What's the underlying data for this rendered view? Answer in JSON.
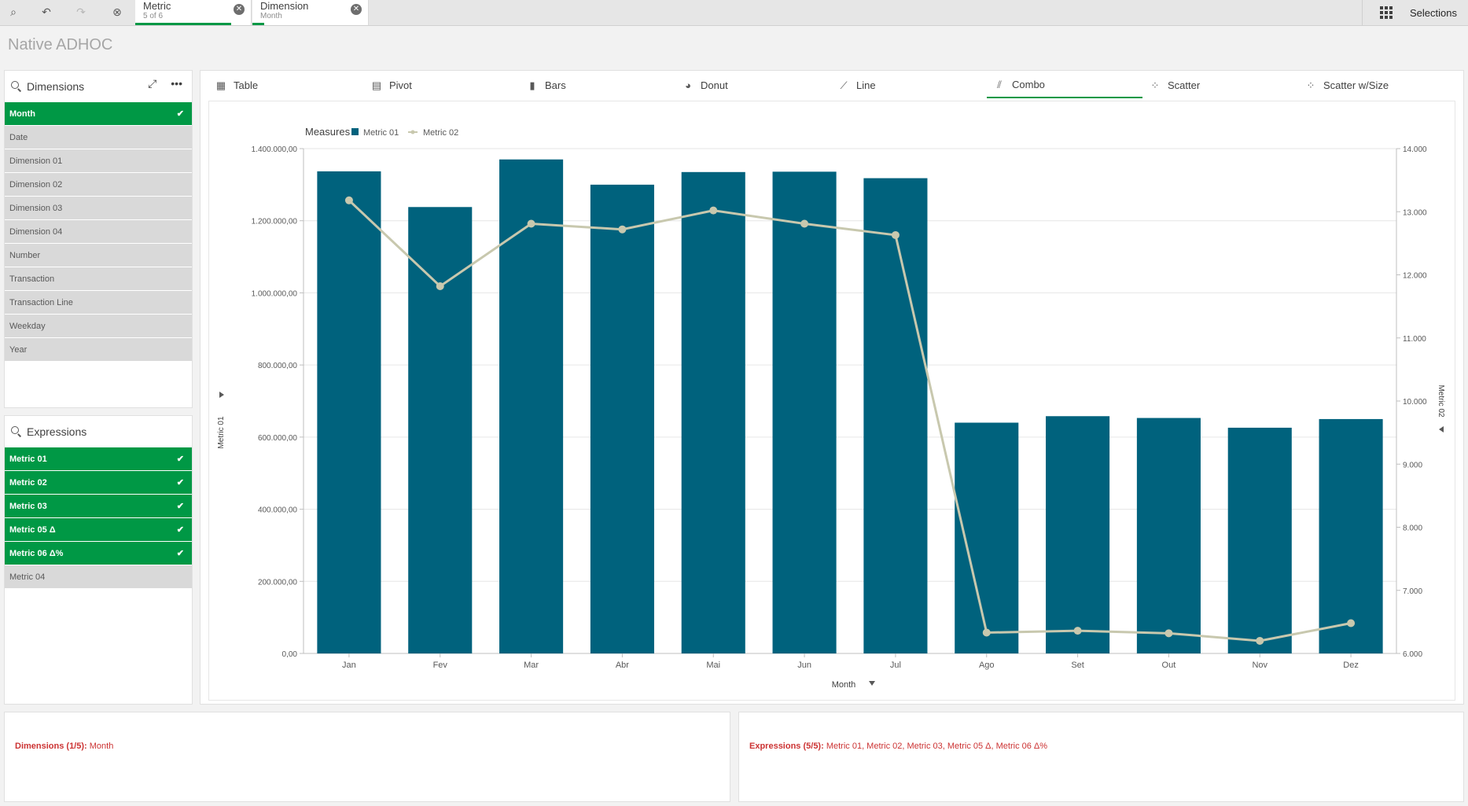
{
  "toolbar": {
    "buttons": [
      {
        "name": "smart-search-icon",
        "glyph": "⌕",
        "disabled": false
      },
      {
        "name": "step-back-icon",
        "glyph": "↶",
        "disabled": false
      },
      {
        "name": "step-forward-icon",
        "glyph": "↷",
        "disabled": true
      },
      {
        "name": "clear-all-selections-icon",
        "glyph": "⊗",
        "disabled": false
      }
    ],
    "chips": [
      {
        "title": "Metric",
        "subtitle": "5 of 6",
        "progress": 0.833
      },
      {
        "title": "Dimension",
        "subtitle": "Month",
        "progress": 0.1
      }
    ],
    "selections_label": "Selections"
  },
  "app_title": "Native ADHOC",
  "dimensions": {
    "title": "Dimensions",
    "items": [
      {
        "label": "Month",
        "selected": true
      },
      {
        "label": "Date",
        "selected": false
      },
      {
        "label": "Dimension 01",
        "selected": false
      },
      {
        "label": "Dimension 02",
        "selected": false
      },
      {
        "label": "Dimension 03",
        "selected": false
      },
      {
        "label": "Dimension 04",
        "selected": false
      },
      {
        "label": "Number",
        "selected": false
      },
      {
        "label": "Transaction",
        "selected": false
      },
      {
        "label": "Transaction Line",
        "selected": false
      },
      {
        "label": "Weekday",
        "selected": false
      },
      {
        "label": "Year",
        "selected": false
      }
    ]
  },
  "expressions": {
    "title": "Expressions",
    "items": [
      {
        "label": "Metric 01",
        "selected": true
      },
      {
        "label": "Metric 02",
        "selected": true
      },
      {
        "label": "Metric 03",
        "selected": true
      },
      {
        "label": "Metric 05 Δ",
        "selected": true
      },
      {
        "label": "Metric 06 Δ%",
        "selected": true
      },
      {
        "label": "Metric 04",
        "selected": false
      }
    ]
  },
  "viz_tabs": [
    {
      "label": "Table",
      "icon": "table-icon",
      "active": false
    },
    {
      "label": "Pivot",
      "icon": "pivot-icon",
      "active": false
    },
    {
      "label": "Bars",
      "icon": "bar-chart-icon",
      "active": false
    },
    {
      "label": "Donut",
      "icon": "donut-chart-icon",
      "active": false
    },
    {
      "label": "Line",
      "icon": "line-chart-icon",
      "active": false
    },
    {
      "label": "Combo",
      "icon": "combo-chart-icon",
      "active": true
    },
    {
      "label": "Scatter",
      "icon": "scatter-icon",
      "active": false
    },
    {
      "label": "Scatter w/Size",
      "icon": "scatter-size-icon",
      "active": false
    }
  ],
  "chart_data": {
    "type": "bar",
    "combo": true,
    "legend_title": "Measures",
    "legend_position": "top-left",
    "categories": [
      "Jan",
      "Fev",
      "Mar",
      "Abr",
      "Mai",
      "Jun",
      "Jul",
      "Ago",
      "Set",
      "Out",
      "Nov",
      "Dez"
    ],
    "series": [
      {
        "name": "Metric 01",
        "kind": "bar",
        "axis": "left",
        "color": "#00627d",
        "values": [
          1337000,
          1238000,
          1370000,
          1300000,
          1335000,
          1336000,
          1318000,
          640000,
          658000,
          653000,
          626000,
          650000
        ]
      },
      {
        "name": "Metric 02",
        "kind": "line",
        "axis": "right",
        "color": "#c8c8ae",
        "values": [
          13180,
          11820,
          12810,
          12720,
          13020,
          12810,
          12630,
          6330,
          6360,
          6320,
          6200,
          6480
        ]
      }
    ],
    "xlabel": "Month",
    "ylabel": "Metric 01",
    "y2label": "Metric 02",
    "ylim": [
      0,
      1400000
    ],
    "y2lim": [
      6000,
      14000
    ],
    "y_ticks": [
      "0,00",
      "200.000,00",
      "400.000,00",
      "600.000,00",
      "800.000,00",
      "1.000.000,00",
      "1.200.000,00",
      "1.400.000,00"
    ],
    "y2_ticks": [
      "6.000",
      "7.000",
      "8.000",
      "9.000",
      "10.000",
      "11.000",
      "12.000",
      "13.000",
      "14.000"
    ],
    "grid": true
  },
  "summary": {
    "dimensions_label": "Dimensions (1/5):",
    "dimensions_value": "Month",
    "expressions_label": "Expressions (5/5):",
    "expressions_value": "Metric 01, Metric 02, Metric 03, Metric 05 Δ, Metric 06 Δ%"
  }
}
